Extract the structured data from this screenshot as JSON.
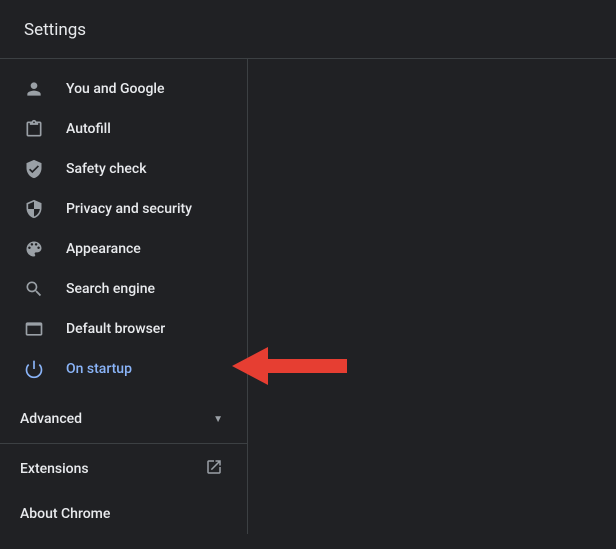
{
  "header": {
    "title": "Settings"
  },
  "sidebar": {
    "items": [
      {
        "label": "You and Google",
        "icon": "person",
        "selected": false
      },
      {
        "label": "Autofill",
        "icon": "clipboard",
        "selected": false
      },
      {
        "label": "Safety check",
        "icon": "shield-check",
        "selected": false
      },
      {
        "label": "Privacy and security",
        "icon": "shield",
        "selected": false
      },
      {
        "label": "Appearance",
        "icon": "palette",
        "selected": false
      },
      {
        "label": "Search engine",
        "icon": "search",
        "selected": false
      },
      {
        "label": "Default browser",
        "icon": "browser",
        "selected": false
      },
      {
        "label": "On startup",
        "icon": "power",
        "selected": true
      }
    ],
    "advanced_label": "Advanced",
    "footer": {
      "extensions_label": "Extensions",
      "about_label": "About Chrome"
    }
  },
  "colors": {
    "background": "#202124",
    "text": "#e8eaed",
    "icon_muted": "#9aa0a6",
    "accent": "#8ab4f8",
    "divider": "#3c4043",
    "annotation_arrow": "#e63e32"
  }
}
